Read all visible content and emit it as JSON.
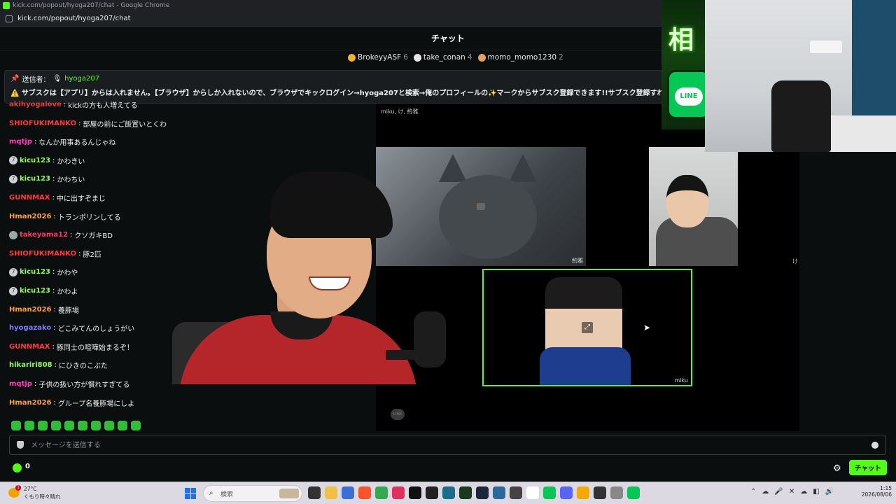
{
  "window": {
    "title": "kick.com/popout/hyoga207/chat - Google Chrome",
    "url": "kick.com/popout/hyoga207/chat"
  },
  "chat": {
    "title": "チャット",
    "leaders": [
      {
        "name": "BrokeyyASF",
        "count": "6",
        "color": "#f2b132"
      },
      {
        "name": "take_conan",
        "count": "4",
        "color": "#e6e6e6"
      },
      {
        "name": "momo_momo1230",
        "count": "2",
        "color": "#e4a060"
      }
    ],
    "pinned": {
      "label": "送信者：",
      "sender": "hyoga207",
      "text": "⚠️ サブスクは【アプリ】からは入れません。【ブラウザ】からしか入れないので、ブラウザでキックログイン→hyoga207と検索→俺のプロフィールの✨マークからサブスク登録できます!!サブスク登録すればサブスク限定"
    },
    "messages": [
      {
        "user": "akihyogalove",
        "text": "kickの方も人増えてる",
        "color": "#e23b3b",
        "badge": ""
      },
      {
        "user": "SHIOFUKIMANKO",
        "text": "部屋の前にご飯置いとくわ",
        "color": "#ff3b3b",
        "badge": ""
      },
      {
        "user": "mqtjp",
        "text": "なんか用事あるんじゃね",
        "color": "#ff3cbd",
        "badge": ""
      },
      {
        "user": "kicu123",
        "text": "かわきい",
        "color": "#8fff56",
        "badge": "7"
      },
      {
        "user": "kicu123",
        "text": "かわちい",
        "color": "#8fff56",
        "badge": "7"
      },
      {
        "user": "GUNNMAX",
        "text": "中に出すぞまじ",
        "color": "#ff3b3b",
        "badge": ""
      },
      {
        "user": "Hman2026",
        "text": "トランポリンしてる",
        "color": "#ff9f3b",
        "badge": ""
      },
      {
        "user": "takeyama12",
        "text": "クソガキBD",
        "color": "#ff3b5c",
        "badge": "img"
      },
      {
        "user": "SHIOFUKIMANKO",
        "text": "豚2匹",
        "color": "#ff3b3b",
        "badge": ""
      },
      {
        "user": "kicu123",
        "text": "かわや",
        "color": "#8fff56",
        "badge": "7"
      },
      {
        "user": "kicu123",
        "text": "かわよ",
        "color": "#8fff56",
        "badge": "7"
      },
      {
        "user": "Hman2026",
        "text": "養豚場",
        "color": "#ff9f3b",
        "badge": ""
      },
      {
        "user": "hyogazako",
        "text": "どこみてんのしょうがい",
        "color": "#7c7cff",
        "badge": ""
      },
      {
        "user": "GUNNMAX",
        "text": "豚同士の喧嘩始まるぞ！",
        "color": "#ff3b3b",
        "badge": ""
      },
      {
        "user": "hikariri808",
        "text": "にひきのこぶた",
        "color": "#8fff56",
        "badge": ""
      },
      {
        "user": "mqtjp",
        "text": "子供の扱い方が慣れすぎてる",
        "color": "#ff3cbd",
        "badge": ""
      },
      {
        "user": "Hman2026",
        "text": "グループ名養豚場にしよ",
        "color": "#ff9f3b",
        "badge": ""
      }
    ],
    "input_placeholder": "メッセージを送信する",
    "points": "0",
    "send_label": "チャット"
  },
  "call": {
    "participants": "miku, け, 約雅",
    "tile_cat_label": "約雅",
    "tile_kid1_label": "け",
    "tile_kid2_label": "miku",
    "line_logo": "LINE"
  },
  "overlay": {
    "banner_kanji": "相",
    "line_badge": "LINE"
  },
  "taskbar": {
    "weather_temp": "27°C",
    "weather_desc": "くもり時々晴れ",
    "weather_alert": "1",
    "search_label": "検索",
    "time": "1:15",
    "date": "2026/08/06"
  }
}
